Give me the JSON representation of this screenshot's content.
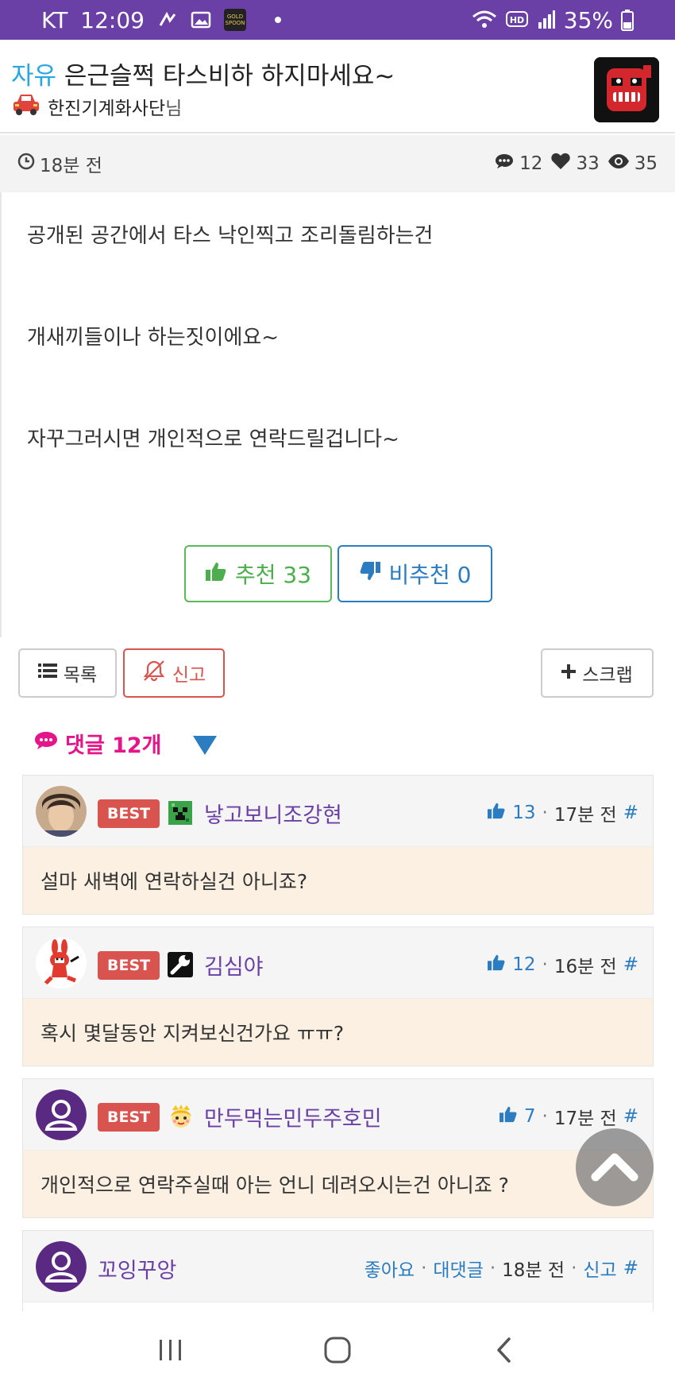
{
  "status_bar": {
    "carrier": "KT",
    "time": "12:09",
    "battery": "35%"
  },
  "post": {
    "category": "자유",
    "title": "은근슬쩍 타스비하 하지마세요~",
    "author": "한진기계화사단",
    "author_suffix": "님",
    "time": "18분 전",
    "comments_count": "12",
    "likes_count": "33",
    "views_count": "35",
    "paragraphs": [
      "공개된 공간에서 타스 낙인찍고 조리돌림하는건",
      "개새끼들이나 하는짓이에요~",
      "자꾸그러시면 개인적으로 연락드릴겁니다~"
    ]
  },
  "votes": {
    "up_label": "추천 33",
    "down_label": "비추천 0"
  },
  "actions": {
    "list_label": "목록",
    "report_label": "신고",
    "scrap_label": "스크랩"
  },
  "comments_header": {
    "label": "댓글 12개"
  },
  "comments": [
    {
      "badge": "BEST",
      "name": "낳고보니조강현",
      "likes": "13",
      "time": "17분 전",
      "hash": "#",
      "text": "설마 새벽에 연락하실건 아니죠?"
    },
    {
      "badge": "BEST",
      "name": "김심야",
      "likes": "12",
      "time": "16분 전",
      "hash": "#",
      "text": "혹시 몇달동안 지켜보신건가요 ㅠㅠ?"
    },
    {
      "badge": "BEST",
      "name": "만두먹는민두주호민",
      "likes": "7",
      "time": "17분 전",
      "hash": "#",
      "text": "개인적으로 연락주실때 아는 언니 데려오시는건 아니죠 ?"
    },
    {
      "name": "꼬잉꾸앙",
      "like_link": "좋아요",
      "reply_link": "대댓글",
      "time": "18분 전",
      "report_link": "신고",
      "hash": "#"
    }
  ],
  "colors": {
    "status_bar": "#6a3fa6",
    "category": "#29a8e0",
    "username": "#6a3fa6",
    "best_badge": "#d9534f",
    "comment_body": "#fcf0e3",
    "comments_header": "#e5158a"
  }
}
